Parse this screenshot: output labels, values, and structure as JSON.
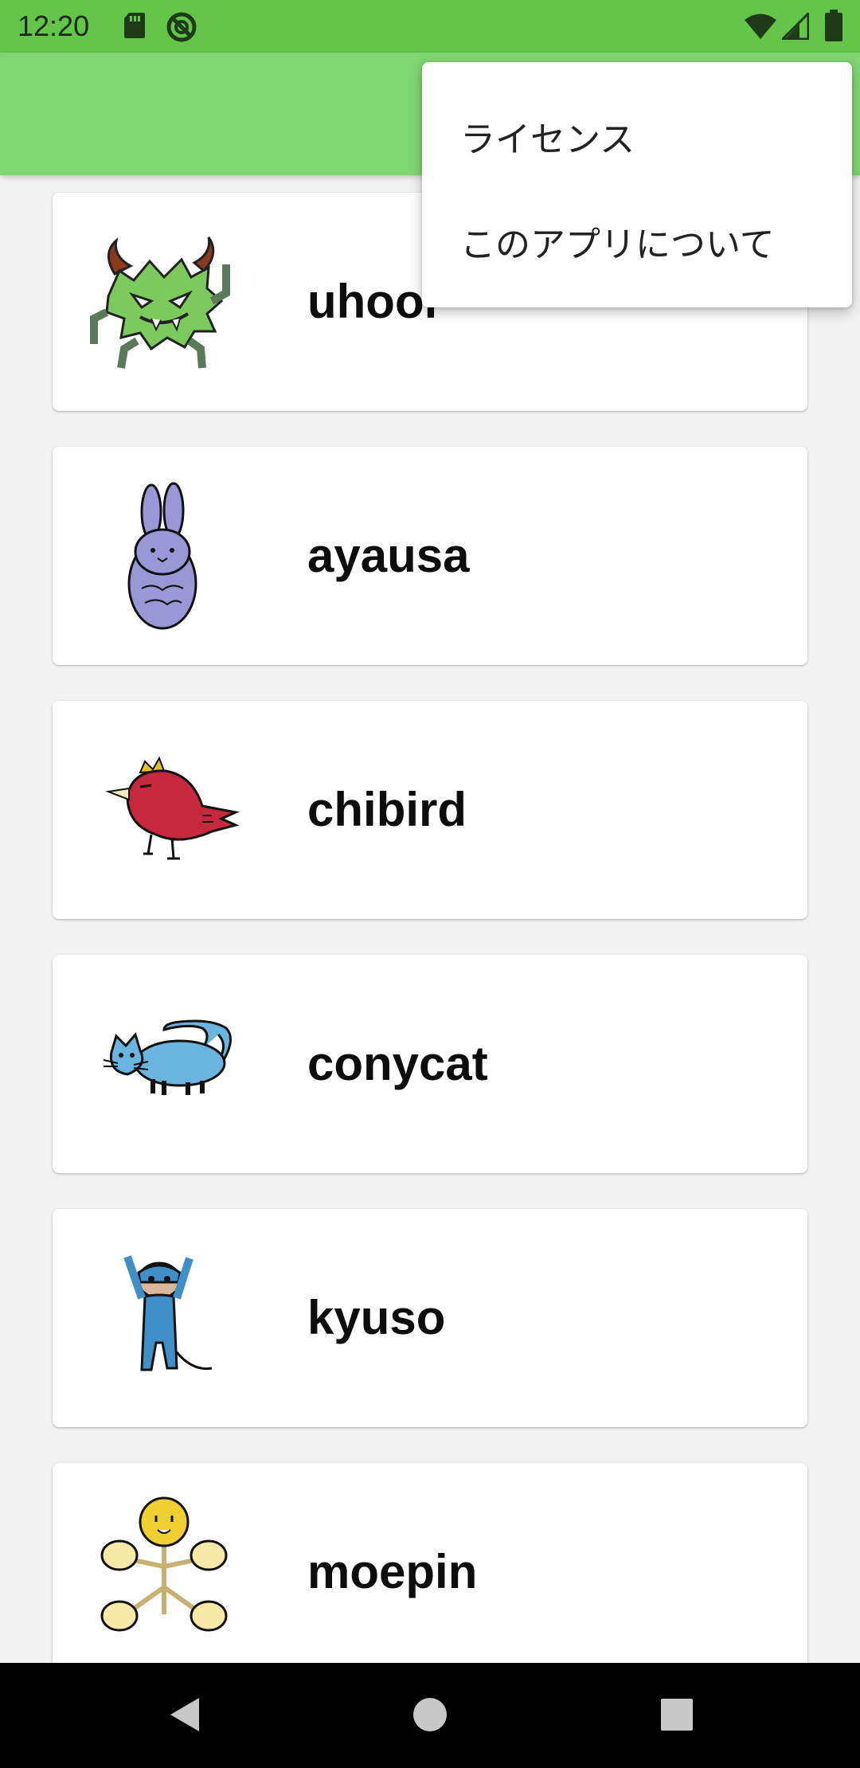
{
  "status_bar": {
    "time": "12:20",
    "left_icons": [
      "sd-card-icon",
      "no-disturb-icon"
    ],
    "right_icons": [
      "wifi-icon",
      "signal-icon",
      "battery-icon"
    ]
  },
  "overflow_menu": {
    "items": [
      {
        "label": "ライセンス"
      },
      {
        "label": "このアプリについて"
      }
    ]
  },
  "characters": [
    {
      "name": "uhooi",
      "icon": "green-monster-icon"
    },
    {
      "name": "ayausa",
      "icon": "purple-rabbit-icon"
    },
    {
      "name": "chibird",
      "icon": "red-bird-icon"
    },
    {
      "name": "conycat",
      "icon": "blue-cat-icon"
    },
    {
      "name": "kyuso",
      "icon": "blue-rat-icon"
    },
    {
      "name": "moepin",
      "icon": "yellow-flower-icon"
    }
  ],
  "nav_bar": {
    "icons": [
      "back-icon",
      "home-icon",
      "recents-icon"
    ]
  },
  "colors": {
    "status_bar": "#64c54a",
    "app_bar": "#80d672",
    "background": "#f2f2f2"
  }
}
